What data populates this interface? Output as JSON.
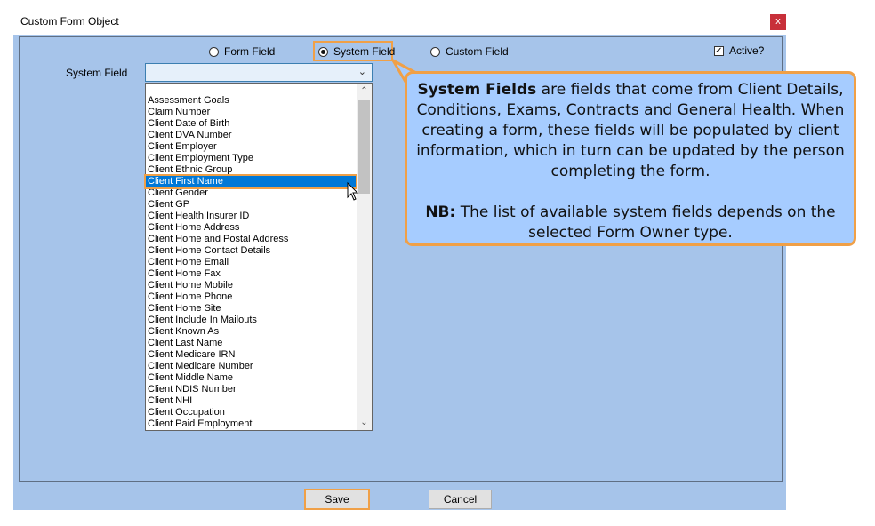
{
  "window": {
    "title": "Custom Form Object",
    "close_label": "x"
  },
  "source_options": [
    {
      "label": "Form Field",
      "selected": false
    },
    {
      "label": "System Field",
      "selected": true
    },
    {
      "label": "Custom Field",
      "selected": false
    }
  ],
  "active": {
    "label": "Active?",
    "checked": true,
    "check_mark": "✓"
  },
  "system_field": {
    "label": "System Field",
    "value": ""
  },
  "dropdown": {
    "items": [
      "Assessment Goals",
      "Claim Number",
      "Client Date of Birth",
      "Client DVA Number",
      "Client Employer",
      "Client Employment Type",
      "Client Ethnic Group",
      "Client First Name",
      "Client Gender",
      "Client GP",
      "Client Health Insurer ID",
      "Client Home Address",
      "Client Home and Postal Address",
      "Client Home Contact Details",
      "Client Home Email",
      "Client Home Fax",
      "Client Home Mobile",
      "Client Home Phone",
      "Client Home Site",
      "Client Include In Mailouts",
      "Client Known As",
      "Client Last Name",
      "Client Medicare IRN",
      "Client Medicare Number",
      "Client Middle Name",
      "Client NDIS Number",
      "Client NHI",
      "Client Occupation",
      "Client Paid Employment"
    ],
    "selected_index": 7,
    "selected_color": "#0078d7"
  },
  "callout": {
    "bold1": "System Fields",
    "text1": " are fields that come from Client Details, Conditions, Exams, Contracts and General Health. When creating a form, these fields will be populated by client information, which in turn can be updated by the person completing the form.",
    "bold2": "NB:",
    "text2": " The list of available system fields depends on the selected Form Owner type.",
    "bg_color": "#a6ccff",
    "border_color": "#f0a047"
  },
  "buttons": {
    "save": "Save",
    "cancel": "Cancel"
  },
  "colors": {
    "dialog_bg": "#a6c4ea",
    "highlight": "#f0a047",
    "close_red": "#c8303a"
  }
}
